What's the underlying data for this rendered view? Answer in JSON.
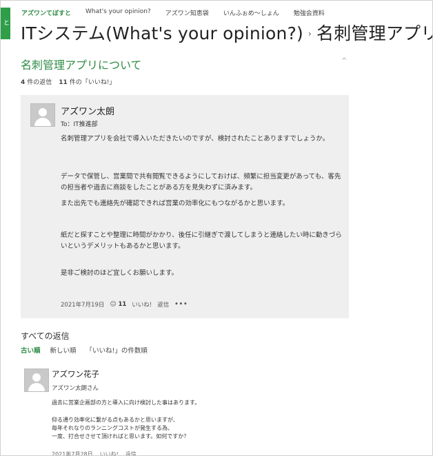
{
  "left_tab": {
    "label": "と"
  },
  "topnav": {
    "items": [
      {
        "label": "アズワンてぼすと",
        "active": true
      },
      {
        "label": "What's your opinion?",
        "active": false
      },
      {
        "label": "アズワン知恵袋",
        "active": false
      },
      {
        "label": "いんふぉめ〜しょん",
        "active": false
      },
      {
        "label": "勉強会資料",
        "active": false
      }
    ]
  },
  "breadcrumb": {
    "part1": "ITシステム(What's your opinion?)",
    "separator": "›",
    "part2": "名刺管理アプリについて"
  },
  "thread": {
    "title": "名刺管理アプリについて",
    "collapse_icon": "^",
    "replies_count": "4",
    "replies_label": "件の返信",
    "likes_count": "11",
    "likes_label": "件の「いいね!」"
  },
  "post": {
    "author": "アズワン太朗",
    "to": "To：IT推進部",
    "paragraphs": [
      "名刺管理アプリを会社で導入いただきたいのですが、検討されたことありますでしょうか。",
      "データで保管し、営業間で共有閲覧できるようにしておけば、頻繁に担当変更があっても、客先の担当者や過去に商談をしたことがある方を見失わずに済みます。",
      "また出先でも連絡先が確認できれば営業の効率化にもつながるかと思います。",
      "紙だと探すことや整理に時間がかかり、後任に引継ぎで渡してしまうと連絡したい時に動きづらいというデメリットもあるかと思います。",
      "是非ご検討のほど宜しくお願いします。"
    ],
    "date": "2021年7月19日",
    "like_icon": "smile-icon",
    "like_count": "11",
    "like_label": "いいね!",
    "reply_label": "返信",
    "more_label": "•••"
  },
  "all_replies": {
    "title": "すべての返信",
    "sorts": [
      {
        "label": "古い順",
        "active": true
      },
      {
        "label": "新しい順",
        "active": false
      },
      {
        "label": "「いいね!」の件数順",
        "active": false
      }
    ]
  },
  "reply": {
    "author": "アズワン花子",
    "to": "アズワン太朗さん",
    "lines": [
      "過去に営業企画部の方と導入に向け検討した事はあります。",
      "仰る通り効率化に繋がる点もあるかと思いますが、",
      "毎年それなりのランニングコストが発生する為、",
      "一度、打合せさせて頂ければと思います。如何ですか？"
    ],
    "date": "2021年7月28日",
    "like_label": "いいね!",
    "reply_label": "返信"
  }
}
